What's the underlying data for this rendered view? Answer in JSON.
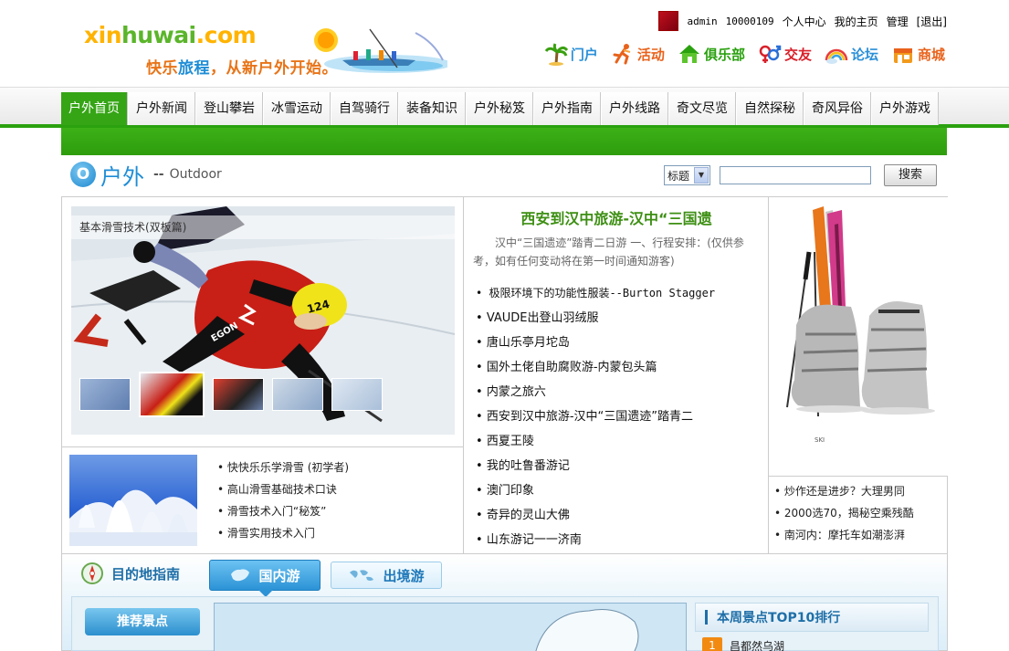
{
  "header": {
    "logo_text_a": "xin",
    "logo_text_b": "huwai",
    "logo_text_c": ".com",
    "slogan_a": "快乐",
    "slogan_b": "旅程",
    "slogan_c": "，从新户外开始。",
    "user": {
      "name": "admin",
      "id": "10000109",
      "links": [
        "个人中心",
        "我的主页",
        "管理",
        "[退出]"
      ]
    },
    "channels": [
      {
        "label": "门户",
        "icon": "palm-tree-icon",
        "color": "#2a8fd8"
      },
      {
        "label": "活动",
        "icon": "runner-icon",
        "color": "#e8621b"
      },
      {
        "label": "俱乐部",
        "icon": "house-icon",
        "color": "#2aa10f"
      },
      {
        "label": "交友",
        "icon": "gender-icon",
        "color": "#d9202a"
      },
      {
        "label": "论坛",
        "icon": "rainbow-icon",
        "color": "#2a8fd8"
      },
      {
        "label": "商城",
        "icon": "shop-icon",
        "color": "#e8621b"
      }
    ]
  },
  "nav": {
    "items": [
      "户外首页",
      "户外新闻",
      "登山攀岩",
      "冰雪运动",
      "自驾骑行",
      "装备知识",
      "户外秘笈",
      "户外指南",
      "户外线路",
      "奇文尽览",
      "自然探秘",
      "奇风异俗",
      "户外游戏"
    ],
    "active_index": 0
  },
  "section": {
    "icon_letter": "O",
    "title_cn": "户外",
    "dash": "--",
    "title_en": "Outdoor"
  },
  "search": {
    "select_value": "标题",
    "input_value": "",
    "button_label": "搜索"
  },
  "slideshow": {
    "caption": "基本滑雪技术(双板篇)",
    "bib_number": "124",
    "suit_text": "EGON",
    "thumbs_count": 6,
    "active_thumb": 1
  },
  "ski_list": [
    "快快乐乐学滑雪 (初学者)",
    "高山滑雪基础技术口诀",
    "滑雪技术入门“秘笈”",
    "滑雪实用技术入门"
  ],
  "headline": {
    "title": "西安到汉中旅游-汉中“三国遗",
    "desc": "汉中“三国遗迹”踏青二日游    一、行程安排：(仅供参考，如有任何变动将在第一时间通知游客)"
  },
  "news_list": [
    "极限环境下的功能性服装--Burton Stagger",
    "VAUDE出登山羽绒服",
    "唐山乐亭月坨岛",
    "国外土佬自助腐败游-内蒙包头篇",
    "内蒙之旅六",
    "西安到汉中旅游-汉中“三国遗迹”踏青二",
    "西夏王陵",
    "我的吐鲁番游记",
    "澳门印象",
    "奇异的灵山大佛",
    "山东游记一一济南"
  ],
  "ski_ad": {
    "caption": "SKI"
  },
  "hot_list": [
    "炒作还是进步？大理男同",
    "2000选70，揭秘空乘残酷",
    "南河内：摩托车如潮澎湃"
  ],
  "dest": {
    "title": "目的地指南",
    "tab_domestic": "国内游",
    "tab_abroad": "出境游",
    "rec_button": "推荐景点",
    "rec_item": "",
    "top10_title": "本周景点TOP10排行",
    "top10_first_rank": "1",
    "top10_first_name": "昌都然乌湖"
  }
}
